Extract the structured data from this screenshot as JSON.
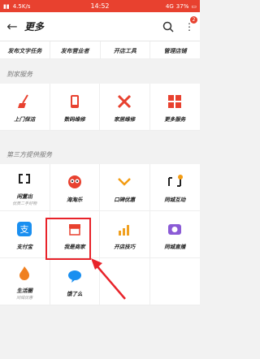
{
  "status": {
    "carrier": "4.5K/s",
    "time": "14:52",
    "network": "4G",
    "battery": "37%"
  },
  "appbar": {
    "title": "更多",
    "notification_count": "2"
  },
  "top_row": [
    "发布文字任务",
    "发布营业者",
    "开店工具",
    "管理店铺"
  ],
  "sections": [
    {
      "title": "到家服务",
      "items": [
        {
          "label": "上门保洁",
          "sub": "",
          "icon": "broom-icon",
          "color": "#e8412f"
        },
        {
          "label": "数码维修",
          "sub": "",
          "icon": "phone-repair-icon",
          "color": "#e8412f"
        },
        {
          "label": "家居维修",
          "sub": "",
          "icon": "tools-icon",
          "color": "#e8412f"
        },
        {
          "label": "更多服务",
          "sub": "",
          "icon": "grid-icon",
          "color": "#e8412f"
        }
      ]
    },
    {
      "title": "第三方提供服务",
      "items": [
        {
          "label": "闲置出",
          "sub": "优质二手好物",
          "icon": "link-icon",
          "color": "#222"
        },
        {
          "label": "海淘乐",
          "sub": "",
          "icon": "face-icon",
          "color": "#e8412f"
        },
        {
          "label": "口碑优惠",
          "sub": "",
          "icon": "coupon-icon",
          "color": "#f39c12"
        },
        {
          "label": "同城互动",
          "sub": "",
          "icon": "chat-icon",
          "color": "#222"
        },
        {
          "label": "支付宝",
          "sub": "",
          "icon": "alipay-icon",
          "color": "#1a8ff0"
        },
        {
          "label": "我是商家",
          "sub": "",
          "icon": "shop-icon",
          "color": "#e8412f"
        },
        {
          "label": "开店技巧",
          "sub": "",
          "icon": "chart-icon",
          "color": "#f0a020"
        },
        {
          "label": "同城直播",
          "sub": "",
          "icon": "camera-icon",
          "color": "#8b5bd6"
        },
        {
          "label": "生活圈",
          "sub": "同城优惠",
          "icon": "fire-icon",
          "color": "#f08020"
        },
        {
          "label": "饿了么",
          "sub": "",
          "icon": "bubble-icon",
          "color": "#1a8ff0"
        },
        {
          "label": "",
          "sub": "",
          "icon": "",
          "color": ""
        },
        {
          "label": "",
          "sub": "",
          "icon": "",
          "color": ""
        }
      ]
    }
  ]
}
